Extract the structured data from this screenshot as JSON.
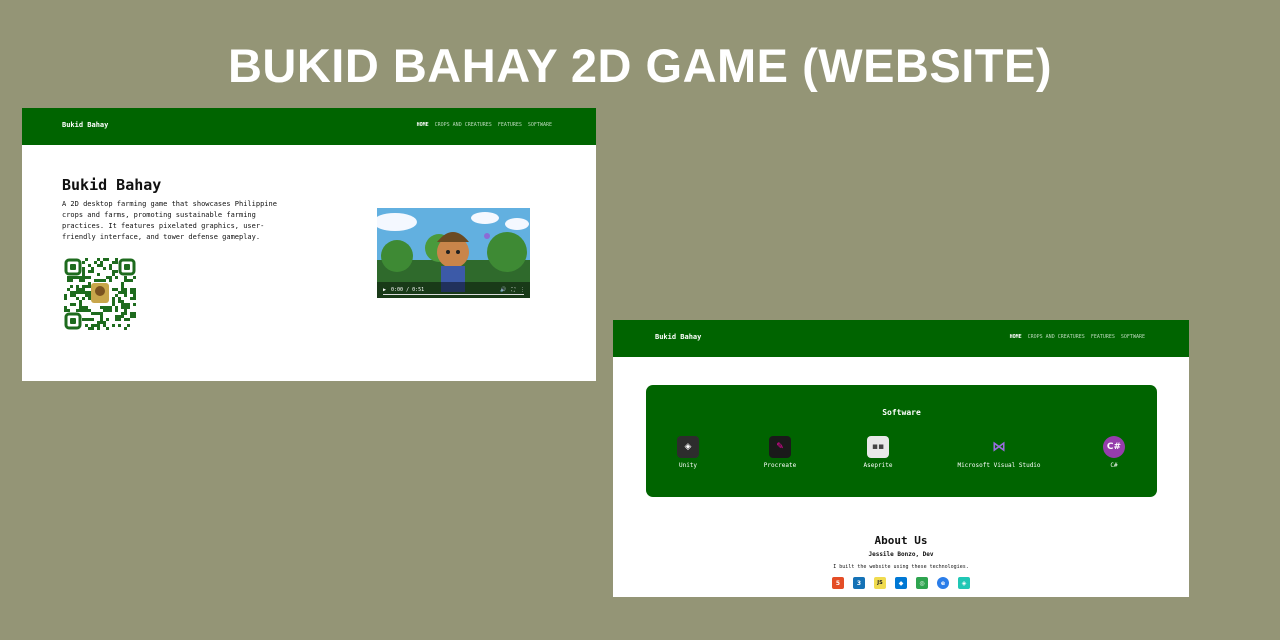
{
  "banner": {
    "title": "BUKID BAHAY 2D GAME (WEBSITE)"
  },
  "site": {
    "brand": "Bukid Bahay",
    "nav": [
      "HOME",
      "CROPS AND CREATURES",
      "FEATURES",
      "SOFTWARE"
    ],
    "active_nav": "HOME"
  },
  "hero": {
    "title": "Bukid Bahay",
    "description": "A 2D desktop farming game that showcases Philippine crops and farms, promoting sustainable farming practices. It features pixelated graphics, user-friendly interface, and tower defense gameplay.",
    "video_time": "0:00 / 0:51"
  },
  "software": {
    "title": "Software",
    "items": [
      {
        "label": "Unity",
        "icon": "unity-icon",
        "color": "#2d2d2d"
      },
      {
        "label": "Procreate",
        "icon": "procreate-icon",
        "color": "#1a1a1a"
      },
      {
        "label": "Aseprite",
        "icon": "aseprite-icon",
        "color": "#e8e8e8"
      },
      {
        "label": "Microsoft Visual Studio",
        "icon": "visual-studio-icon",
        "color": "#8a5cd6"
      },
      {
        "label": "C#",
        "icon": "csharp-icon",
        "color": "#953dac"
      }
    ]
  },
  "about": {
    "title": "About Us",
    "author": "Jessile Bonzo, Dev",
    "note": "I built the website using these technologies.",
    "tech": [
      {
        "icon": "html5-icon",
        "color": "#e44d26",
        "glyph": "5"
      },
      {
        "icon": "css3-icon",
        "color": "#1572b6",
        "glyph": "3"
      },
      {
        "icon": "javascript-icon",
        "color": "#f0db4f",
        "glyph": "JS"
      },
      {
        "icon": "vscode-icon",
        "color": "#0078d4",
        "glyph": "◆"
      },
      {
        "icon": "github-desktop-icon",
        "color": "#2ea44f",
        "glyph": "◎"
      },
      {
        "icon": "edge-icon",
        "color": "#2b7de9",
        "glyph": "e"
      },
      {
        "icon": "figma-icon",
        "color": "#20c7b5",
        "glyph": "◈"
      }
    ]
  },
  "colors": {
    "nav_green": "#006400",
    "background": "#949576"
  }
}
